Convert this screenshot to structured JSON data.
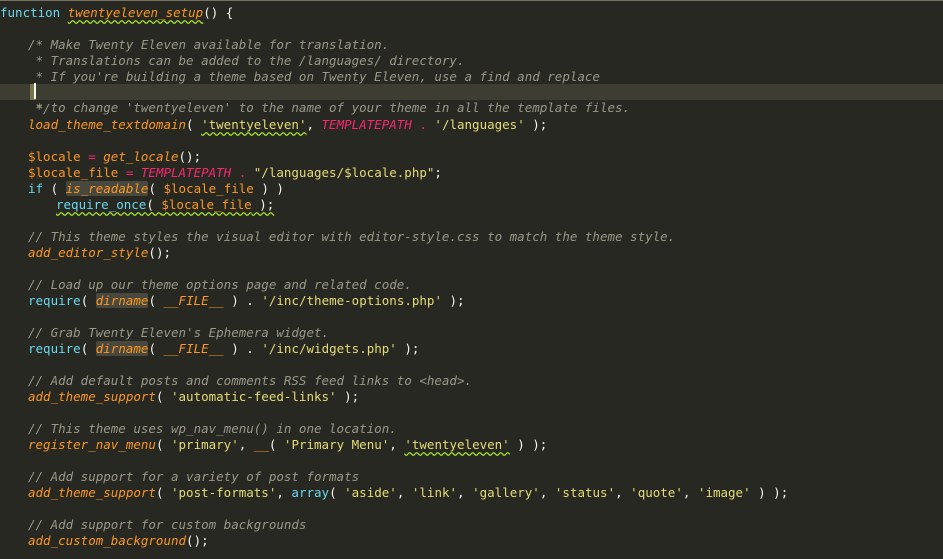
{
  "editor": {
    "lines": [
      {
        "id": "l1",
        "tokens": [
          [
            "function ",
            "kw"
          ],
          [
            "twentyeleven_setup",
            "fn squig"
          ],
          [
            "() {",
            "pun"
          ]
        ]
      },
      {
        "id": "l3",
        "tokens": [
          [
            "/* Make Twenty Eleven available for translation.",
            "cmt"
          ]
        ]
      },
      {
        "id": "l4",
        "tokens": [
          [
            " * Translations can be added to the /languages/ directory.",
            "cmt"
          ]
        ]
      },
      {
        "id": "l5",
        "tokens": [
          [
            " * If you're building a theme based on Twenty Eleven, use a find and replace",
            "cmt"
          ]
        ]
      },
      {
        "id": "l6",
        "tokens": [
          [
            " * to change 'twentyeleven' to the name of your theme in all the template files.",
            "cmt"
          ]
        ]
      },
      {
        "id": "l7",
        "tokens": [
          [
            " */",
            "cmt"
          ]
        ]
      },
      {
        "id": "l8",
        "tokens": [
          [
            "load_theme_textdomain",
            "fn"
          ],
          [
            "( ",
            "pun"
          ],
          [
            "'twentyeleven'",
            "str squig"
          ],
          [
            ", ",
            "pun"
          ],
          [
            "TEMPLATEPATH",
            "tpl"
          ],
          [
            " . ",
            "op"
          ],
          [
            "'/languages'",
            "str"
          ],
          [
            " );",
            "pun"
          ]
        ]
      },
      {
        "id": "l10",
        "tokens": [
          [
            "$locale",
            "var"
          ],
          [
            " = ",
            "op"
          ],
          [
            "get_locale",
            "fn"
          ],
          [
            "();",
            "pun"
          ]
        ]
      },
      {
        "id": "l11",
        "tokens": [
          [
            "$locale_file",
            "var"
          ],
          [
            " = ",
            "op"
          ],
          [
            "TEMPLATEPATH",
            "tpl"
          ],
          [
            " . ",
            "op"
          ],
          [
            "\"/languages/$locale.php\"",
            "str"
          ],
          [
            ";",
            "pun"
          ]
        ]
      },
      {
        "id": "l12",
        "tokens": [
          [
            "if",
            "kw"
          ],
          [
            " ( ",
            "pun"
          ],
          [
            "is_readable",
            "fn hl"
          ],
          [
            "( ",
            "pun"
          ],
          [
            "$locale_file",
            "var"
          ],
          [
            " ) )",
            "pun"
          ]
        ]
      },
      {
        "id": "l13",
        "tokens": [
          [
            "require_once",
            "kw squig"
          ],
          [
            "( ",
            "pun squig"
          ],
          [
            "$locale_file",
            "var squig"
          ],
          [
            " );",
            "pun squig"
          ]
        ]
      },
      {
        "id": "l15",
        "tokens": [
          [
            "// This theme styles the visual editor with editor-style.css to match the theme style.",
            "cmt"
          ]
        ]
      },
      {
        "id": "l16",
        "tokens": [
          [
            "add_editor_style",
            "fn"
          ],
          [
            "();",
            "pun"
          ]
        ]
      },
      {
        "id": "l18",
        "tokens": [
          [
            "// Load up our theme options page and related code.",
            "cmt"
          ]
        ]
      },
      {
        "id": "l19",
        "tokens": [
          [
            "require",
            "kw"
          ],
          [
            "( ",
            "pun"
          ],
          [
            "dirname",
            "fn hl"
          ],
          [
            "( ",
            "pun"
          ],
          [
            "__FILE__",
            "magic"
          ],
          [
            " ) . ",
            "pun"
          ],
          [
            "'/inc/theme-options.php'",
            "str"
          ],
          [
            " );",
            "pun"
          ]
        ]
      },
      {
        "id": "l21",
        "tokens": [
          [
            "// Grab Twenty Eleven's Ephemera widget.",
            "cmt"
          ]
        ]
      },
      {
        "id": "l22",
        "tokens": [
          [
            "require",
            "kw"
          ],
          [
            "( ",
            "pun"
          ],
          [
            "dirname",
            "fn hl"
          ],
          [
            "( ",
            "pun"
          ],
          [
            "__FILE__",
            "magic"
          ],
          [
            " ) . ",
            "pun"
          ],
          [
            "'/inc/widgets.php'",
            "str"
          ],
          [
            " );",
            "pun"
          ]
        ]
      },
      {
        "id": "l24",
        "tokens": [
          [
            "// Add default posts and comments RSS feed links to <head>.",
            "cmt"
          ]
        ]
      },
      {
        "id": "l25",
        "tokens": [
          [
            "add_theme_support",
            "fn"
          ],
          [
            "( ",
            "pun"
          ],
          [
            "'automatic-feed-links'",
            "str"
          ],
          [
            " );",
            "pun"
          ]
        ]
      },
      {
        "id": "l27",
        "tokens": [
          [
            "// This theme uses wp_nav_menu() in one location.",
            "cmt"
          ]
        ]
      },
      {
        "id": "l28",
        "tokens": [
          [
            "register_nav_menu",
            "fn"
          ],
          [
            "( ",
            "pun"
          ],
          [
            "'primary'",
            "str"
          ],
          [
            ", ",
            "pun"
          ],
          [
            "__",
            "fn"
          ],
          [
            "( ",
            "pun"
          ],
          [
            "'Primary Menu'",
            "str"
          ],
          [
            ", ",
            "pun"
          ],
          [
            "'twentyeleven'",
            "str squig"
          ],
          [
            " ) );",
            "pun"
          ]
        ]
      },
      {
        "id": "l30",
        "tokens": [
          [
            "// Add support for a variety of post formats",
            "cmt"
          ]
        ]
      },
      {
        "id": "l31",
        "tokens": [
          [
            "add_theme_support",
            "fn"
          ],
          [
            "( ",
            "pun"
          ],
          [
            "'post-formats'",
            "str"
          ],
          [
            ", ",
            "pun"
          ],
          [
            "array",
            "kw"
          ],
          [
            "( ",
            "pun"
          ],
          [
            "'aside'",
            "str"
          ],
          [
            ", ",
            "pun"
          ],
          [
            "'link'",
            "str"
          ],
          [
            ", ",
            "pun"
          ],
          [
            "'gallery'",
            "str"
          ],
          [
            ", ",
            "pun"
          ],
          [
            "'status'",
            "str"
          ],
          [
            ", ",
            "pun"
          ],
          [
            "'quote'",
            "str"
          ],
          [
            ", ",
            "pun"
          ],
          [
            "'image'",
            "str"
          ],
          [
            " ) );",
            "pun"
          ]
        ]
      },
      {
        "id": "l33",
        "tokens": [
          [
            "// Add support for custom backgrounds",
            "cmt"
          ]
        ]
      },
      {
        "id": "l34",
        "tokens": [
          [
            "add_custom_background",
            "fn"
          ],
          [
            "();",
            "pun"
          ]
        ]
      }
    ]
  },
  "colors": {
    "background": "#272822",
    "keyword": "#66d9ef",
    "function": "#fd971f",
    "string": "#e6db74",
    "comment": "#9a9886",
    "constant": "#f92672"
  }
}
